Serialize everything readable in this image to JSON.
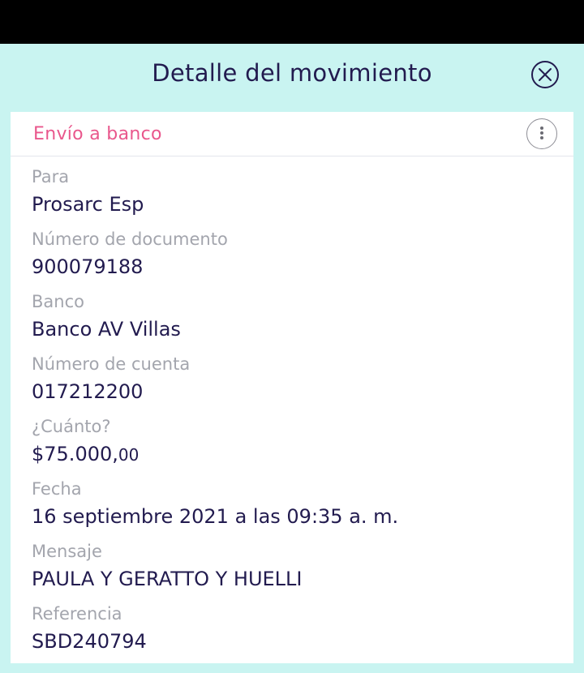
{
  "header": {
    "title": "Detalle del movimiento",
    "close_icon": "close-circle-icon"
  },
  "card": {
    "title": "Envío a banco",
    "menu_icon": "more-vertical-icon"
  },
  "details": {
    "recipient_label": "Para",
    "recipient_value": "Prosarc Esp",
    "document_label": "Número de documento",
    "document_value": "900079188",
    "bank_label": "Banco",
    "bank_value": "Banco AV Villas",
    "account_label": "Número de cuenta",
    "account_value": "017212200",
    "amount_label": "¿Cuánto?",
    "amount_integer": "$75.000,",
    "amount_cents": "00",
    "date_label": "Fecha",
    "date_value": "16 septiembre 2021 a las 09:35 a. m.",
    "message_label": "Mensaje",
    "message_value": "PAULA Y GERATTO Y HUELLI",
    "reference_label": "Referencia",
    "reference_value": "SBD240794"
  },
  "colors": {
    "background": "#c9f4f1",
    "primary_text": "#221b4f",
    "label_text": "#a3a5ad",
    "accent": "#e9578c",
    "card": "#ffffff"
  }
}
